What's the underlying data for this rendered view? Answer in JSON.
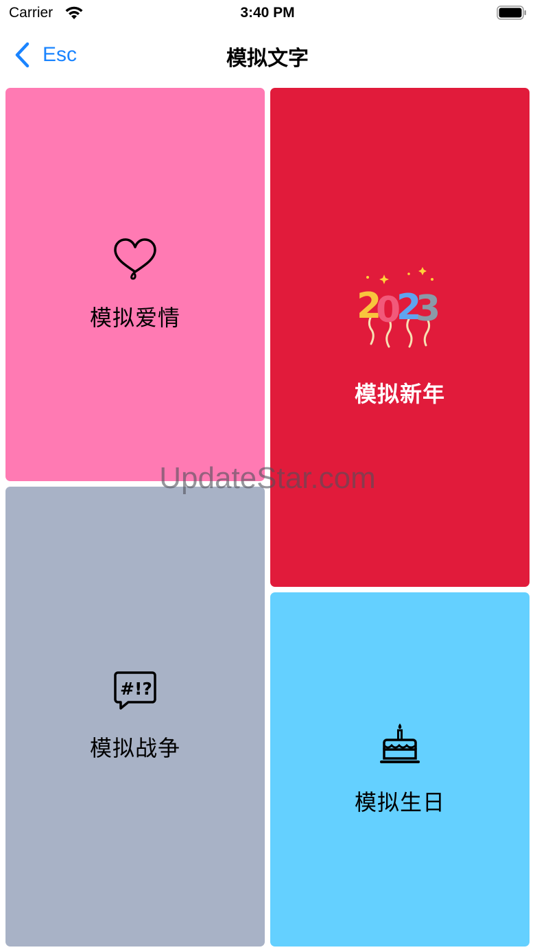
{
  "status_bar": {
    "carrier": "Carrier",
    "time": "3:40 PM"
  },
  "nav": {
    "back_label": "Esc",
    "title": "模拟文字"
  },
  "cards": {
    "love": {
      "label": "模拟爱情",
      "icon": "heart-icon",
      "color": "#ff7ab3"
    },
    "newyear": {
      "label": "模拟新年",
      "icon": "balloons-2023-icon",
      "color": "#e11b3b"
    },
    "war": {
      "label": "模拟战争",
      "icon": "swearing-speech-bubble-icon",
      "color": "#a8b2c6"
    },
    "birthday": {
      "label": "模拟生日",
      "icon": "birthday-cake-icon",
      "color": "#64d0ff"
    }
  },
  "watermark": "UpdateStar.com",
  "colors": {
    "accent": "#1a84ff"
  }
}
